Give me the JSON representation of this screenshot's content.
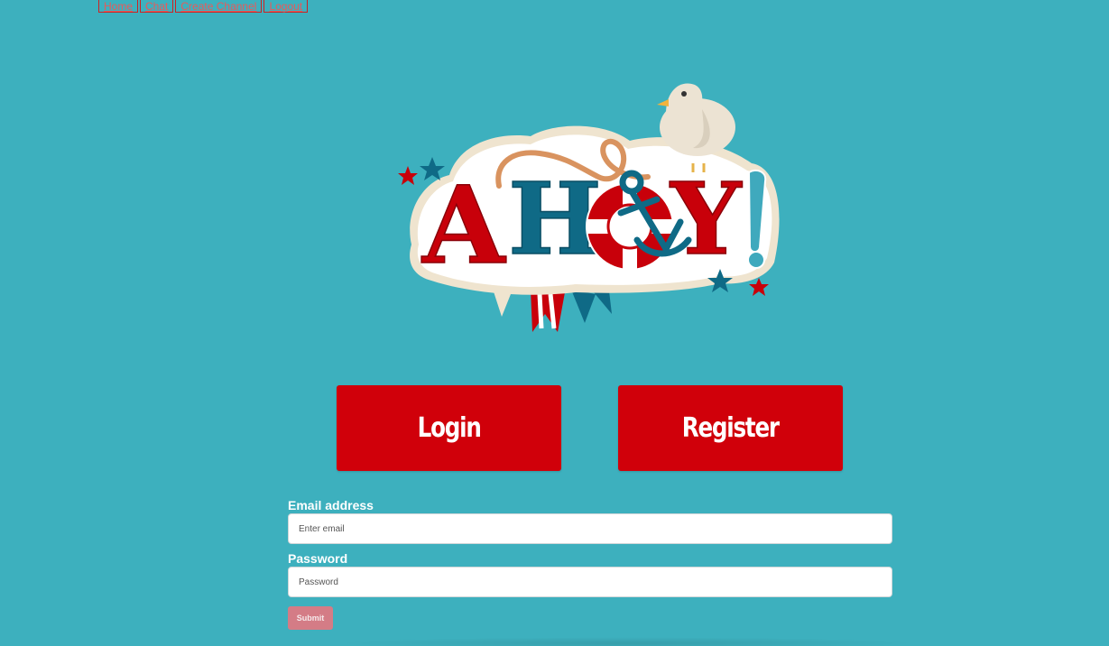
{
  "nav": {
    "items": [
      {
        "label": "Home"
      },
      {
        "label": "Chat"
      },
      {
        "label": "Create Channel"
      },
      {
        "label": "Logout"
      }
    ]
  },
  "logo": {
    "text": "AHOY!",
    "icons": [
      "seagull-icon",
      "anchor-icon",
      "life-ring-icon",
      "rope-icon",
      "star-icon",
      "bunting-icon"
    ]
  },
  "buttons": {
    "login_label": "Login",
    "register_label": "Register"
  },
  "form": {
    "email_label": "Email address",
    "email_placeholder": "Enter email",
    "email_value": "",
    "password_label": "Password",
    "password_placeholder": "Password",
    "password_value": "",
    "submit_label": "Submit"
  },
  "colors": {
    "background": "#3db0be",
    "accent_red": "#d0000a",
    "submit_pink": "#d47c86",
    "logo_teal": "#0f6a86",
    "logo_cream": "#efe4cf"
  }
}
